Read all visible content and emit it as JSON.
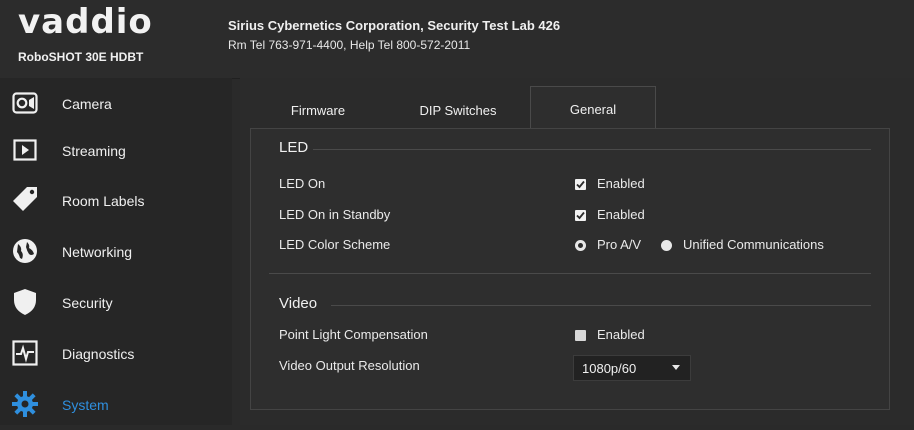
{
  "brand": {
    "logo_text": "vaddio",
    "model": "RoboSHOT 30E HDBT"
  },
  "header": {
    "organization": "Sirius Cybernetics Corporation, Security Test Lab 426",
    "phones": "Rm Tel 763-971-4400, Help Tel 800-572-2011"
  },
  "sidebar": {
    "items": [
      {
        "label": "Camera",
        "icon": "camera-icon"
      },
      {
        "label": "Streaming",
        "icon": "play-icon"
      },
      {
        "label": "Room Labels",
        "icon": "tag-icon"
      },
      {
        "label": "Networking",
        "icon": "globe-icon"
      },
      {
        "label": "Security",
        "icon": "shield-icon"
      },
      {
        "label": "Diagnostics",
        "icon": "pulse-icon"
      },
      {
        "label": "System",
        "icon": "gear-icon",
        "active": true
      }
    ]
  },
  "tabs": [
    {
      "label": "Firmware"
    },
    {
      "label": "DIP Switches"
    },
    {
      "label": "General",
      "active": true
    }
  ],
  "panel": {
    "led": {
      "title": "LED",
      "led_on": {
        "label": "LED On",
        "checkbox": "Enabled",
        "checked": true
      },
      "led_standby": {
        "label": "LED On in Standby",
        "checkbox": "Enabled",
        "checked": true
      },
      "color_scheme": {
        "label": "LED Color Scheme",
        "options": [
          {
            "label": "Pro A/V",
            "selected": true
          },
          {
            "label": "Unified Communications",
            "selected": false
          }
        ]
      }
    },
    "video": {
      "title": "Video",
      "plc": {
        "label": "Point Light Compensation",
        "checkbox": "Enabled",
        "checked": false
      },
      "resolution": {
        "label": "Video Output Resolution",
        "value": "1080p/60"
      }
    }
  },
  "colors": {
    "accent": "#2f8fde",
    "background": "#2a2a2a",
    "text": "#f0f0f0"
  }
}
